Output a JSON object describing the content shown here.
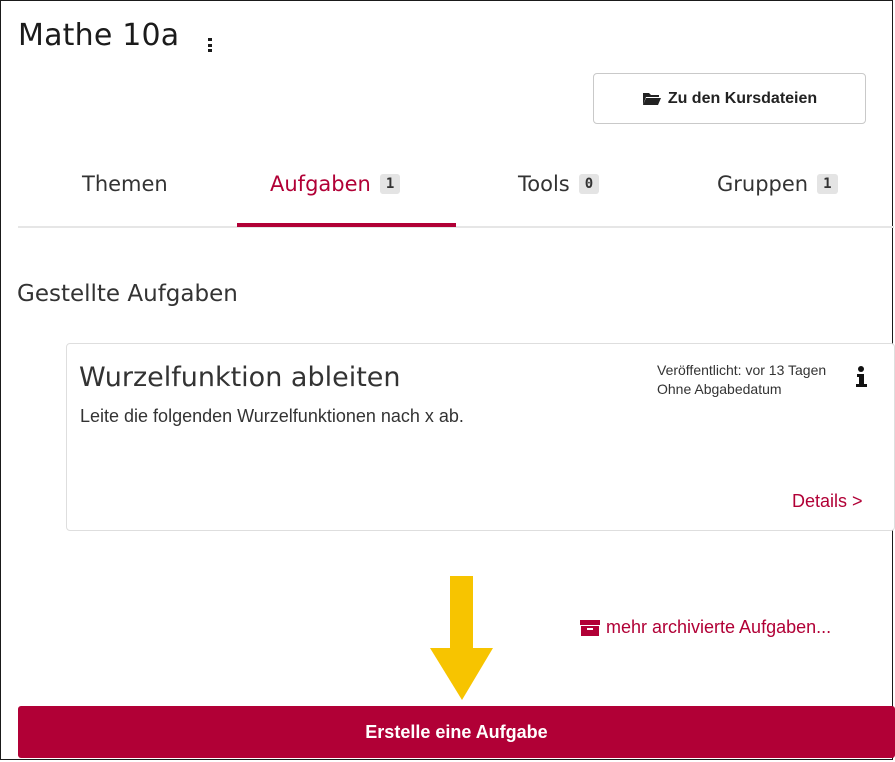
{
  "course": {
    "title": "Mathe 10a",
    "files_button_label": "Zu den Kursdateien"
  },
  "tabs": [
    {
      "label": "Themen",
      "count": null,
      "active": false
    },
    {
      "label": "Aufgaben",
      "count": "1",
      "active": true
    },
    {
      "label": "Tools",
      "count": "0",
      "active": false
    },
    {
      "label": "Gruppen",
      "count": "1",
      "active": false
    }
  ],
  "section": {
    "title": "Gestellte Aufgaben"
  },
  "task": {
    "title": "Wurzelfunktion ableiten",
    "description": "Leite die folgenden Wurzelfunktionen nach x ab.",
    "published": "Veröffentlicht: vor 13 Tagen",
    "due": "Ohne Abgabedatum",
    "details_label": "Details >"
  },
  "archive_link_label": "mehr archivierte Aufgaben...",
  "create_button_label": "Erstelle eine Aufgabe",
  "icons": {
    "menu": "vertical-dots-icon",
    "files": "folder-open-icon",
    "info": "info-icon",
    "archive": "archive-box-icon",
    "annotation": "down-arrow-icon"
  },
  "colors": {
    "accent": "#b10036",
    "badge_bg": "#e4e4e4",
    "annotation_arrow": "#f7c400"
  }
}
